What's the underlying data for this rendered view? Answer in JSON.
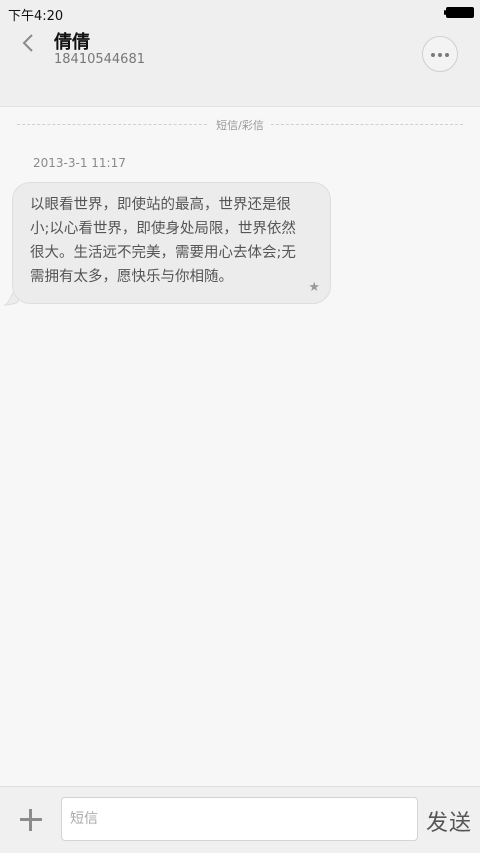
{
  "status_bar": {
    "time": "下午4:20"
  },
  "header": {
    "contact_name": "倩倩",
    "contact_number": "18410544681"
  },
  "conversation": {
    "divider_label": "短信/彩信",
    "messages": [
      {
        "timestamp": "2013-3-1 11:17",
        "lines": [
          "以眼看世界，即使站的最高，世界还是很",
          "小;以心看世界，即使身处局限，世界依然",
          "很大。生活远不完美，需要用心去体会;无",
          "需拥有太多，愿快乐与你相随。"
        ],
        "starred": true
      }
    ]
  },
  "input_bar": {
    "placeholder": "短信",
    "send_label": "发送"
  },
  "icons": {
    "back": "chevron-left-icon",
    "more": "more-dots-icon",
    "star": "star-icon",
    "add": "plus-icon"
  }
}
